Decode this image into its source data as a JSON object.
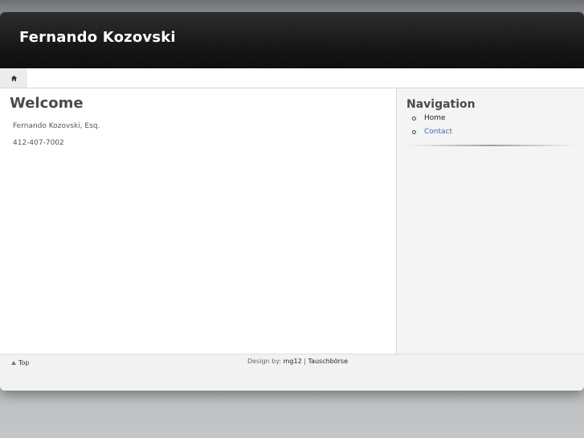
{
  "header": {
    "title": "Fernando Kozovski"
  },
  "navbar": {
    "home_icon": "home-icon"
  },
  "main": {
    "heading": "Welcome",
    "paragraphs": [
      "Fernando Kozovski, Esq.",
      "412-407-7002"
    ]
  },
  "sidebar": {
    "heading": "Navigation",
    "items": [
      {
        "label": "Home"
      },
      {
        "label": "Contact"
      }
    ]
  },
  "footer": {
    "top_link": "Top",
    "design_by": "Design by:",
    "credit_1": "mg12",
    "separator": "|",
    "credit_2": "Tauschbörse"
  },
  "colors": {
    "link": "#3a6ea5",
    "header_bg": "#111111"
  }
}
